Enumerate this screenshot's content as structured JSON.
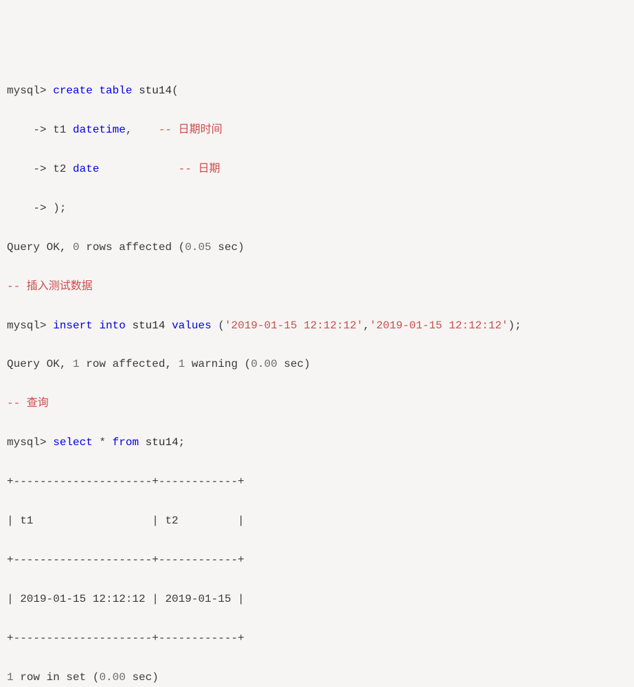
{
  "lines": {
    "l1": {
      "prompt": "mysql> ",
      "kw_create": "create",
      "sp1": " ",
      "kw_table": "table",
      "sp2": " ",
      "tbl": "stu14",
      "paren": "("
    },
    "l2": {
      "cont": "    -> t1 ",
      "kw": "datetime",
      "comma": ",    ",
      "cmt": "-- 日期时间"
    },
    "l3": {
      "cont": "    -> t2 ",
      "kw": "date",
      "pad": "            ",
      "cmt": "-- 日期"
    },
    "l4": {
      "cont": "    -> );"
    },
    "l5": {
      "pre": "Query OK, ",
      "n1": "0",
      "mid": " rows affected (",
      "n2": "0.05",
      "suf": " sec)"
    },
    "l6": {
      "cmt": "-- 插入测试数据"
    },
    "l7": {
      "prompt": "mysql> ",
      "kw_ins": "insert",
      "sp1": " ",
      "kw_into": "into",
      "sp2": " ",
      "tbl": "stu14",
      "sp3": " ",
      "kw_vals": "values",
      "sp4": " (",
      "s1": "'2019-01-15 12:12:12'",
      "c": ",",
      "s2": "'2019-01-15 12:12:12'",
      "end": ");"
    },
    "l8": {
      "pre": "Query OK, ",
      "n1": "1",
      "mid1": " row affected, ",
      "n2": "1",
      "mid2": " warning (",
      "n3": "0.00",
      "suf": " sec)"
    },
    "l9": {
      "cmt": "-- 查询"
    },
    "l10": {
      "prompt": "mysql> ",
      "kw_sel": "select",
      "sp1": " * ",
      "kw_from": "from",
      "sp2": " ",
      "tbl": "stu14",
      "end": ";"
    },
    "l11": {
      "sep": "+---------------------+------------+"
    },
    "l12": {
      "hdr": "| t1                  | t2         |"
    },
    "l13": {
      "sep": "+---------------------+------------+"
    },
    "l14": {
      "row": "| 2019-01-15 12:12:12 | 2019-01-15 |"
    },
    "l15": {
      "sep": "+---------------------+------------+"
    },
    "l16": {
      "n1": "1",
      "mid": " row in set (",
      "n2": "0.00",
      "suf": " sec)"
    }
  }
}
